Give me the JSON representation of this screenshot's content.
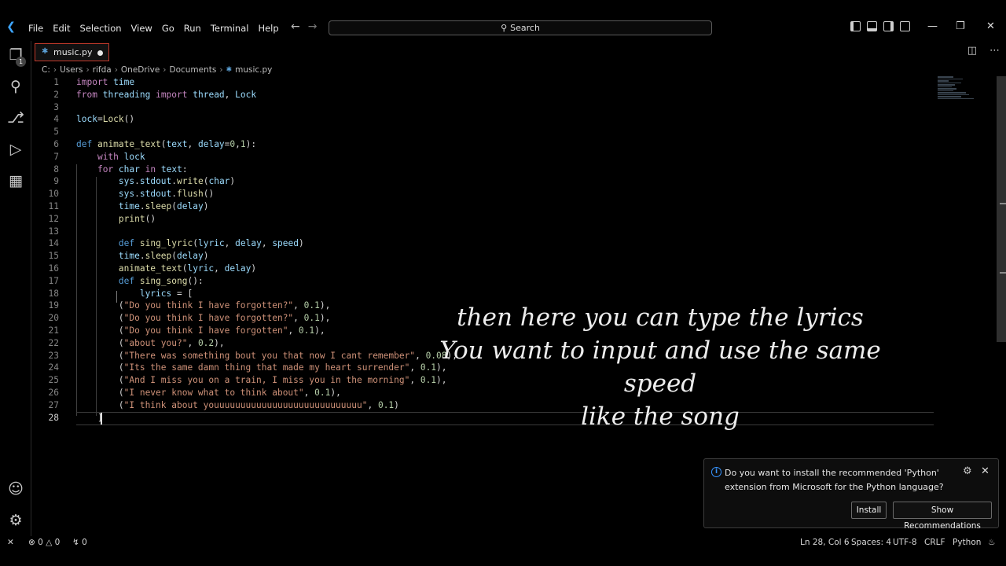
{
  "menu": [
    "File",
    "Edit",
    "Selection",
    "View",
    "Go",
    "Run",
    "Terminal",
    "Help"
  ],
  "search": {
    "label": "Search"
  },
  "tab": {
    "filename": "music.py"
  },
  "breadcrumb": [
    "C:",
    "Users",
    "rifda",
    "OneDrive",
    "Documents",
    "music.py"
  ],
  "activity": {
    "badge": "1"
  },
  "code_lines": [
    {
      "n": "1",
      "text": "import time"
    },
    {
      "n": "2",
      "text": "from threading import thread, Lock"
    },
    {
      "n": "3",
      "text": ""
    },
    {
      "n": "4",
      "text": "lock=Lock()"
    },
    {
      "n": "5",
      "text": ""
    },
    {
      "n": "6",
      "text": "def animate_text(text, delay=0,1):"
    },
    {
      "n": "7",
      "text": "    with lock"
    },
    {
      "n": "8",
      "text": "    for char in text:"
    },
    {
      "n": "9",
      "text": "        sys.stdout.write(char)"
    },
    {
      "n": "10",
      "text": "        sys.stdout.flush()"
    },
    {
      "n": "11",
      "text": "        time.sleep(delay)"
    },
    {
      "n": "12",
      "text": "        print()"
    },
    {
      "n": "13",
      "text": ""
    },
    {
      "n": "14",
      "text": "        def sing_lyric(lyric, delay, speed)"
    },
    {
      "n": "15",
      "text": "        time.sleep(delay)"
    },
    {
      "n": "16",
      "text": "        animate_text(lyric, delay)"
    },
    {
      "n": "17",
      "text": "        def sing_song():"
    },
    {
      "n": "18",
      "text": "            lyrics = ["
    },
    {
      "n": "19",
      "text": "        (\"Do you think I have forgotten?\", 0.1),"
    },
    {
      "n": "20",
      "text": "        (\"Do you think I have forgotten?\", 0.1),"
    },
    {
      "n": "21",
      "text": "        (\"Do you think I have forgotten\", 0.1),"
    },
    {
      "n": "22",
      "text": "        (\"about you?\", 0.2),"
    },
    {
      "n": "23",
      "text": "        (\"There was something bout you that now I cant remember\", 0.08),"
    },
    {
      "n": "24",
      "text": "        (\"Its the same damn thing that made my heart surrender\", 0.1),"
    },
    {
      "n": "25",
      "text": "        (\"And I miss you on a train, I miss you in the morning\", 0.1),"
    },
    {
      "n": "26",
      "text": "        (\"I never know what to think about\", 0.1),"
    },
    {
      "n": "27",
      "text": "        (\"I think about youuuuuuuuuuuuuuuuuuuuuuuuuuuu\", 0.1)"
    },
    {
      "n": "28",
      "text": "    ]"
    }
  ],
  "caption": {
    "line1": "then here you can type the lyrics",
    "line2": "You want to input and use the same speed",
    "line3": "like the song"
  },
  "notification": {
    "message": "Do you want to install the recommended 'Python' extension from Microsoft for the Python language?",
    "install": "Install",
    "show_recs": "Show Recommendations"
  },
  "status": {
    "errors": "0",
    "warnings": "0",
    "ports": "0",
    "position": "Ln 28, Col 6",
    "spaces": "Spaces: 4",
    "encoding": "UTF-8",
    "eol": "CRLF",
    "language": "Python"
  }
}
